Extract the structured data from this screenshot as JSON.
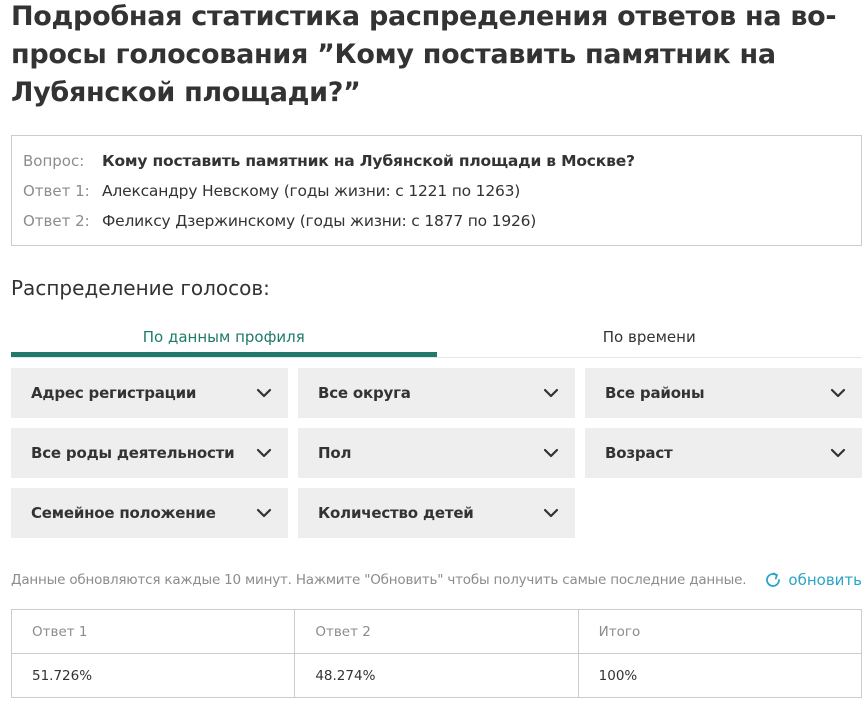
{
  "page_title": "Подробная статистика распределения ответов на во-просы голосования ”Кому поставить памятник на Лубянской площади?”",
  "question_box": {
    "rows": [
      {
        "label": "Вопрос:",
        "value": "Кому поставить памятник на Лубянской площади в Москве?"
      },
      {
        "label": "Ответ 1:",
        "value": "Александру Невскому (годы жизни: с 1221 по 1263)"
      },
      {
        "label": "Ответ 2:",
        "value": "Феликсу Дзержинскому (годы жизни: с 1877 по 1926)"
      }
    ]
  },
  "distribution": {
    "title": "Распределение голосов:",
    "tabs": [
      {
        "label": "По данным профиля",
        "active": true
      },
      {
        "label": "По времени",
        "active": false
      }
    ],
    "filters": [
      {
        "label": "Адрес регистрации"
      },
      {
        "label": "Все округа"
      },
      {
        "label": "Все районы"
      },
      {
        "label": "Все роды деятельности"
      },
      {
        "label": "Пол"
      },
      {
        "label": "Возраст"
      },
      {
        "label": "Семейное положение"
      },
      {
        "label": "Количество детей"
      }
    ]
  },
  "update": {
    "note": "Данные обновляются каждые 10 минут. Нажмите \"Обновить\" чтобы получить самые последние данные.",
    "refresh_label": "обновить",
    "refresh_icon": "refresh-icon"
  },
  "results": {
    "headers": [
      "Ответ 1",
      "Ответ 2",
      "Итого"
    ],
    "values": [
      "51.726%",
      "48.274%",
      "100%"
    ]
  },
  "colors": {
    "accent": "#1f7a6b",
    "link": "#2aa4c8",
    "filter_bg": "#eeeeee",
    "muted_text": "#8c8c8c"
  }
}
